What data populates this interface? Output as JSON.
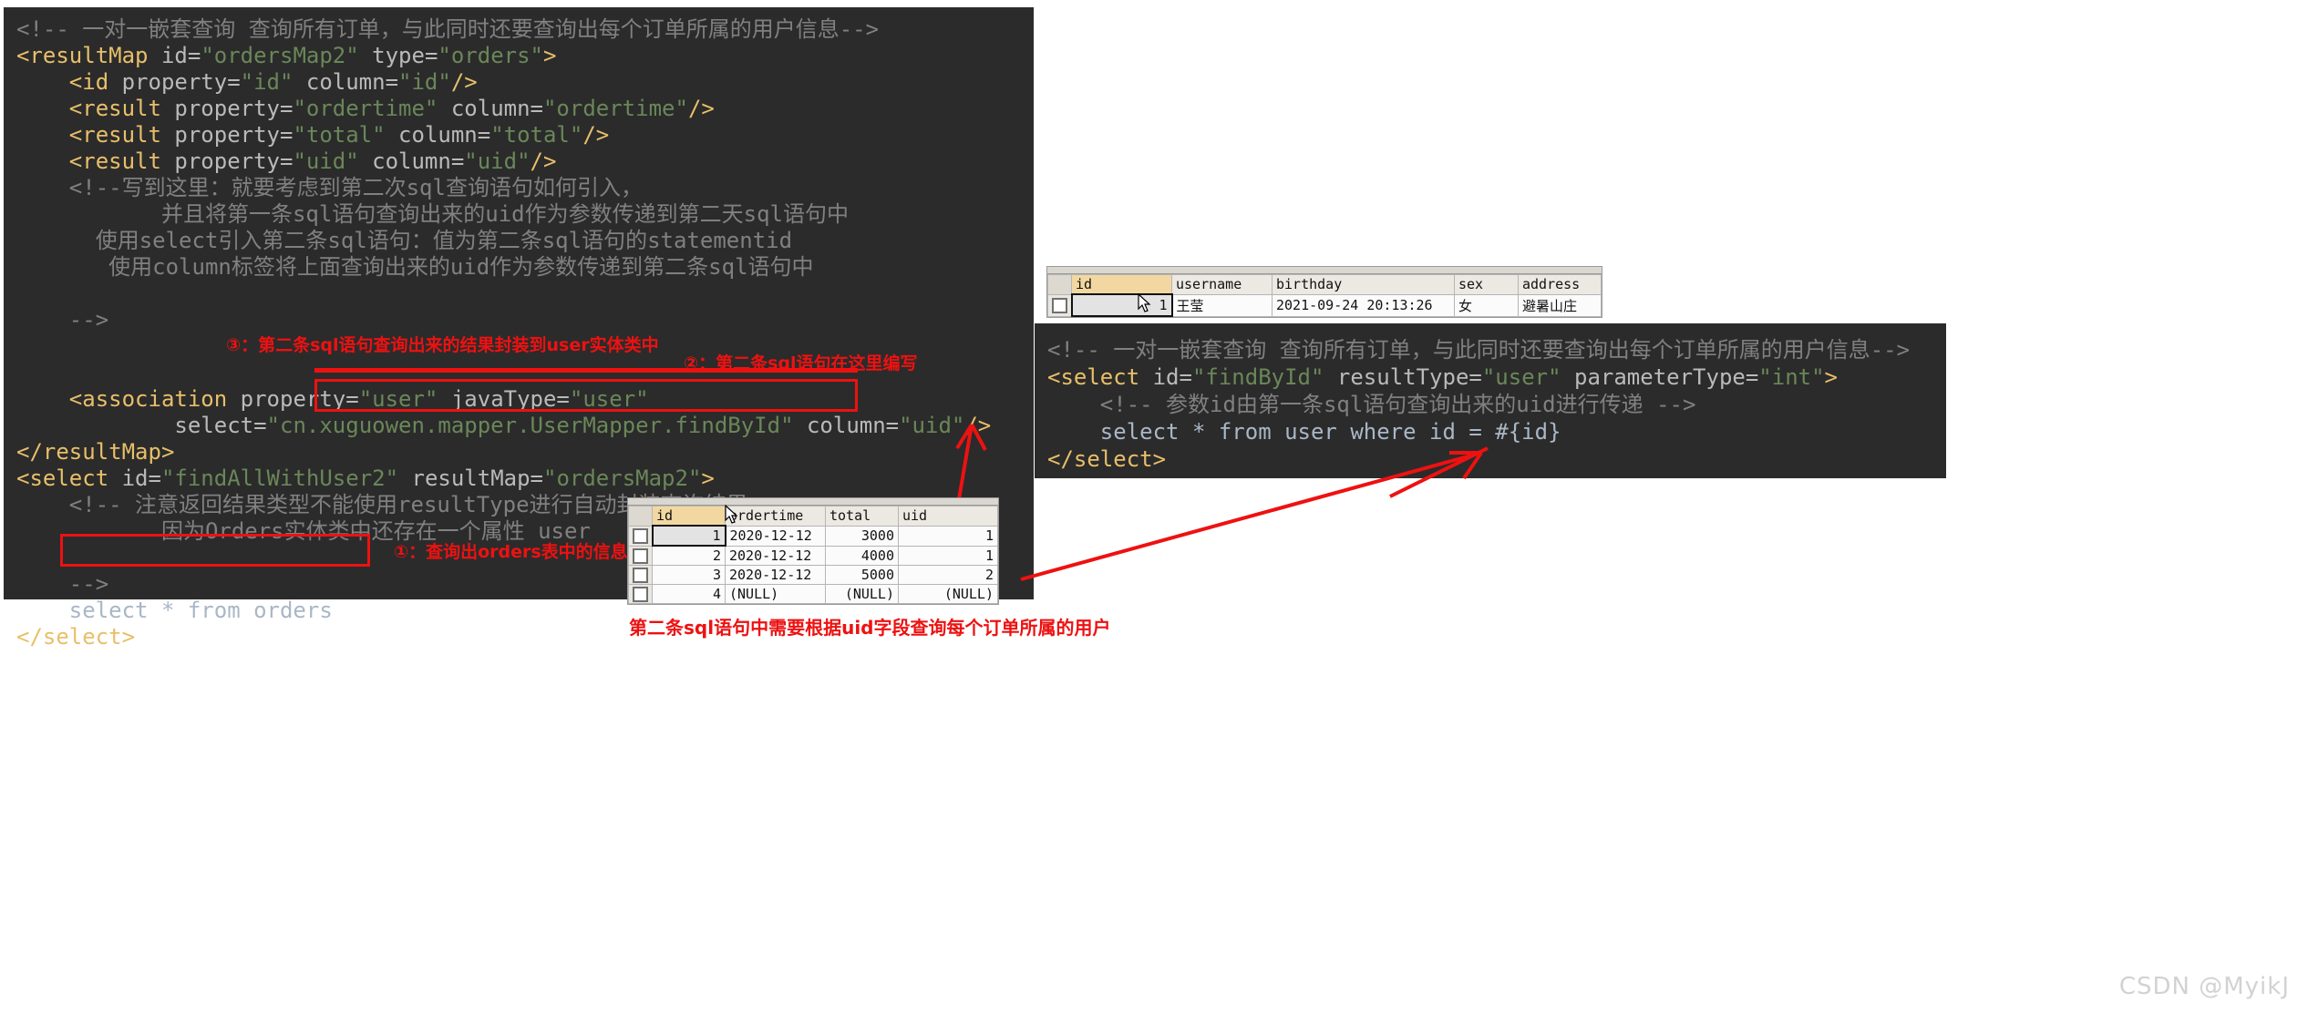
{
  "left_code": {
    "lines": [
      [
        {
          "t": "<!-- 一对一嵌套查询 查询所有订单，与此同时还要查询出每个订单所属的用户信息-->",
          "c": "cmt"
        }
      ],
      [
        {
          "t": "<resultMap ",
          "c": "tag"
        },
        {
          "t": "id=",
          "c": "attr"
        },
        {
          "t": "\"ordersMap2\"",
          "c": "str"
        },
        {
          "t": " type=",
          "c": "attr"
        },
        {
          "t": "\"orders\"",
          "c": "str"
        },
        {
          "t": ">",
          "c": "tag"
        }
      ],
      [
        {
          "t": "    <id ",
          "c": "tag"
        },
        {
          "t": "property=",
          "c": "attr"
        },
        {
          "t": "\"id\"",
          "c": "str"
        },
        {
          "t": " column=",
          "c": "attr"
        },
        {
          "t": "\"id\"",
          "c": "str"
        },
        {
          "t": "/>",
          "c": "tag"
        }
      ],
      [
        {
          "t": "    <result ",
          "c": "tag"
        },
        {
          "t": "property=",
          "c": "attr"
        },
        {
          "t": "\"ordertime\"",
          "c": "str"
        },
        {
          "t": " column=",
          "c": "attr"
        },
        {
          "t": "\"ordertime\"",
          "c": "str"
        },
        {
          "t": "/>",
          "c": "tag"
        }
      ],
      [
        {
          "t": "    <result ",
          "c": "tag"
        },
        {
          "t": "property=",
          "c": "attr"
        },
        {
          "t": "\"total\"",
          "c": "str"
        },
        {
          "t": " column=",
          "c": "attr"
        },
        {
          "t": "\"total\"",
          "c": "str"
        },
        {
          "t": "/>",
          "c": "tag"
        }
      ],
      [
        {
          "t": "    <result ",
          "c": "tag"
        },
        {
          "t": "property=",
          "c": "attr"
        },
        {
          "t": "\"uid\"",
          "c": "str"
        },
        {
          "t": " column=",
          "c": "attr"
        },
        {
          "t": "\"uid\"",
          "c": "str"
        },
        {
          "t": "/>",
          "c": "tag"
        }
      ],
      [
        {
          "t": "    <!--写到这里：就要考虑到第二次sql查询语句如何引入，",
          "c": "cmt"
        }
      ],
      [
        {
          "t": "           并且将第一条sql语句查询出来的uid作为参数传递到第二天sql语句中",
          "c": "cmt"
        }
      ],
      [
        {
          "t": "      使用select引入第二条sql语句：值为第二条sql语句的statementid",
          "c": "cmt"
        }
      ],
      [
        {
          "t": "       使用column标签将上面查询出来的uid作为参数传递到第二条sql语句中",
          "c": "cmt"
        }
      ],
      [
        {
          "t": "",
          "c": "cmt"
        }
      ],
      [
        {
          "t": "    -->",
          "c": "cmt"
        }
      ],
      [
        {
          "t": "",
          "c": "plain"
        }
      ],
      [
        {
          "t": "",
          "c": "plain"
        }
      ],
      [
        {
          "t": "    <association ",
          "c": "tag"
        },
        {
          "t": "property=",
          "c": "attr"
        },
        {
          "t": "\"user\"",
          "c": "str"
        },
        {
          "t": " javaType=",
          "c": "attr"
        },
        {
          "t": "\"user\"",
          "c": "str"
        }
      ],
      [
        {
          "t": "            select=",
          "c": "attr"
        },
        {
          "t": "\"cn.xuguowen.mapper.UserMapper.findById\"",
          "c": "str"
        },
        {
          "t": " column=",
          "c": "attr"
        },
        {
          "t": "\"uid\"",
          "c": "str"
        },
        {
          "t": "/>",
          "c": "tag"
        }
      ],
      [
        {
          "t": "</resultMap>",
          "c": "tag"
        }
      ],
      [
        {
          "t": "<select ",
          "c": "tag"
        },
        {
          "t": "id=",
          "c": "attr"
        },
        {
          "t": "\"findAllWithUser2\"",
          "c": "str"
        },
        {
          "t": " resultMap=",
          "c": "attr"
        },
        {
          "t": "\"ordersMap2\"",
          "c": "str"
        },
        {
          "t": ">",
          "c": "tag"
        }
      ],
      [
        {
          "t": "    <!-- 注意返回结果类型不能使用resultType进行自动封装查询结果，",
          "c": "cmt"
        }
      ],
      [
        {
          "t": "           因为Orders实体类中还存在一个属性 user",
          "c": "cmt"
        }
      ],
      [
        {
          "t": "",
          "c": "cmt"
        }
      ],
      [
        {
          "t": "    -->",
          "c": "cmt"
        }
      ],
      [
        {
          "t": "    select * from orders",
          "c": "plain"
        }
      ],
      [
        {
          "t": "</select>",
          "c": "tag"
        }
      ]
    ]
  },
  "right_code": {
    "lines": [
      [
        {
          "t": "<!-- 一对一嵌套查询 查询所有订单，与此同时还要查询出每个订单所属的用户信息-->",
          "c": "cmt"
        }
      ],
      [
        {
          "t": "<select ",
          "c": "tag"
        },
        {
          "t": "id=",
          "c": "attr"
        },
        {
          "t": "\"findById\"",
          "c": "str"
        },
        {
          "t": " resultType=",
          "c": "attr"
        },
        {
          "t": "\"user\"",
          "c": "str"
        },
        {
          "t": " parameterType=",
          "c": "attr"
        },
        {
          "t": "\"int\"",
          "c": "str"
        },
        {
          "t": ">",
          "c": "tag"
        }
      ],
      [
        {
          "t": "    <!-- 参数id由第一条sql语句查询出来的uid进行传递 -->",
          "c": "cmt"
        }
      ],
      [
        {
          "t": "    select * from user where id = #{id}",
          "c": "plain"
        }
      ],
      [
        {
          "t": "</select>",
          "c": "tag"
        }
      ]
    ]
  },
  "annotations": {
    "note1": "①：查询出orders表中的信息",
    "note2": "②：第二条sql语句在这里编写",
    "note3": "③：第二条sql语句查询出来的结果封装到user实体类中",
    "caption": "第二条sql语句中需要根据uid字段查询每个订单所属的用户",
    "accent_color": "#ee1111"
  },
  "user_table": {
    "headers": [
      "id",
      "username",
      "birthday",
      "sex",
      "address"
    ],
    "rows": [
      {
        "id": "1",
        "username": "王莹",
        "birthday": "2021-09-24 20:13:26",
        "sex": "女",
        "address": "避暑山庄"
      }
    ]
  },
  "orders_table": {
    "headers": [
      "id",
      "ordertime",
      "total",
      "uid"
    ],
    "rows": [
      {
        "id": "1",
        "ordertime": "2020-12-12",
        "total": "3000",
        "uid": "1"
      },
      {
        "id": "2",
        "ordertime": "2020-12-12",
        "total": "4000",
        "uid": "1"
      },
      {
        "id": "3",
        "ordertime": "2020-12-12",
        "total": "5000",
        "uid": "2"
      },
      {
        "id": "4",
        "ordertime": "(NULL)",
        "total": "(NULL)",
        "uid": "(NULL)"
      }
    ]
  },
  "watermark": {
    "text": "CSDN @MyikJ"
  }
}
